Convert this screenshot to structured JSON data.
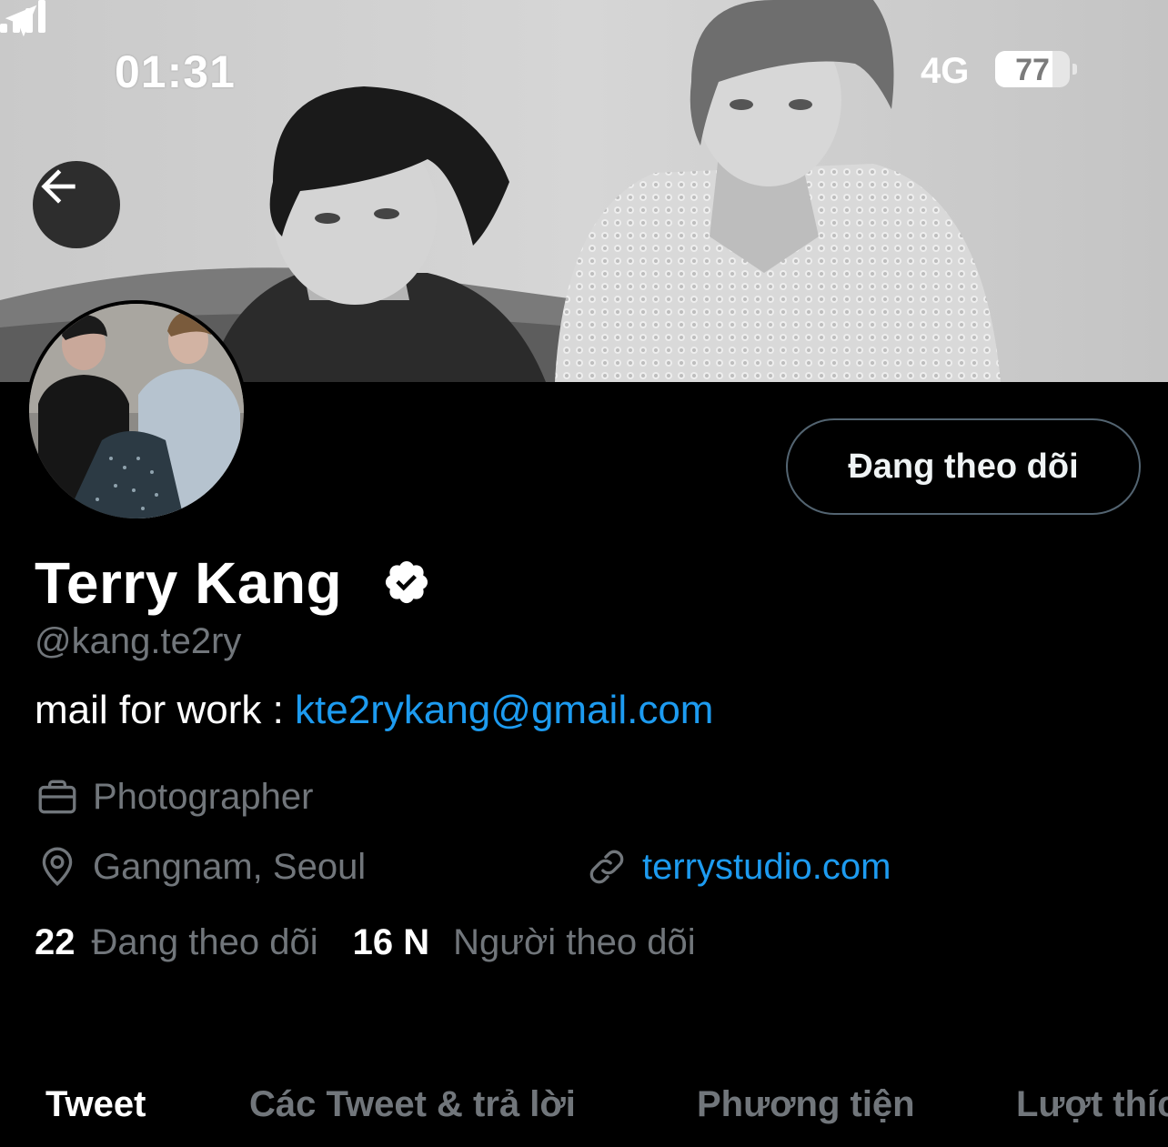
{
  "status_bar": {
    "time": "01:31",
    "network": "4G",
    "battery": "77",
    "battery_level": 0.77
  },
  "profile": {
    "follow_button_label": "Đang theo dõi",
    "display_name": "Terry Kang",
    "handle": "@kang.te2ry",
    "bio_prefix": "mail for work : ",
    "bio_email": "kte2rykang@gmail.com",
    "profession": "Photographer",
    "location": "Gangnam, Seoul",
    "website": "terrystudio.com",
    "following_count": "22",
    "following_label": "Đang theo dõi",
    "followers_count": "16 N",
    "followers_label": "Người theo dõi"
  },
  "tabs": [
    {
      "label": "Tweet",
      "active": true
    },
    {
      "label": "Các Tweet & trả lời",
      "active": false
    },
    {
      "label": "Phương tiện",
      "active": false
    },
    {
      "label": "Lượt thích",
      "active": false
    }
  ],
  "colors": {
    "background": "#000000",
    "link": "#1d9bf0",
    "secondary_text": "#71767b",
    "button_border": "#536471"
  },
  "icons": [
    "location-arrow-icon",
    "signal-icon",
    "back-arrow-icon",
    "verified-badge-icon",
    "briefcase-icon",
    "location-pin-icon",
    "link-icon"
  ]
}
